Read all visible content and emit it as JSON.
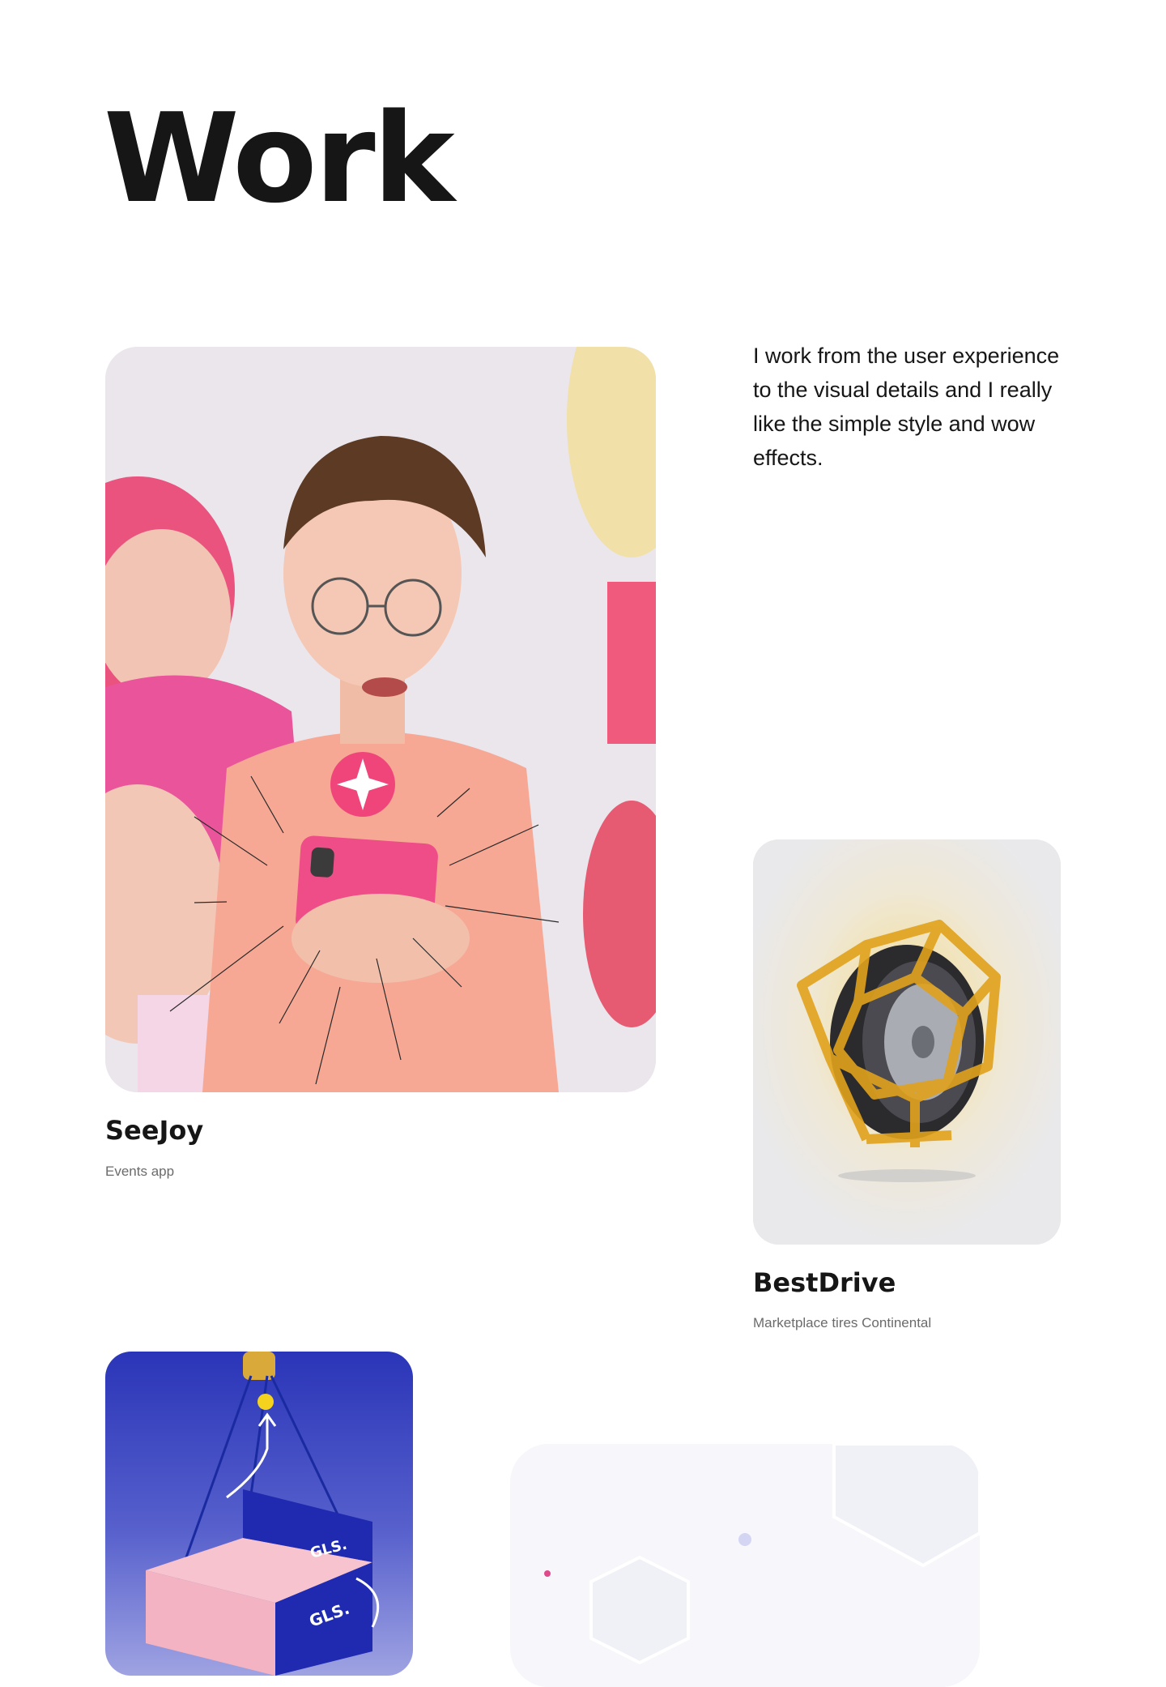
{
  "page": {
    "title": "Work",
    "intro": "I work from the user experience to the visual details and I really like the simple style and wow effects."
  },
  "projects": [
    {
      "title": "SeeJoy",
      "subtitle": "Events app",
      "image_icon": "people-with-phone-photo"
    },
    {
      "title": "BestDrive",
      "subtitle": "Marketplace tires Continental",
      "image_icon": "tire-in-golden-cage-render"
    },
    {
      "title": "",
      "subtitle": "",
      "image_icon": "gls-parcel-box-illustration",
      "box_text": "GLS."
    },
    {
      "title": "",
      "subtitle": "",
      "image_icon": "hexagon-abstract-render"
    }
  ],
  "colors": {
    "text": "#161616",
    "muted": "#6b6b6b",
    "seejoy_pink": "#f0457a",
    "gold": "#e0a21c",
    "gls_blue": "#2a35b8"
  }
}
